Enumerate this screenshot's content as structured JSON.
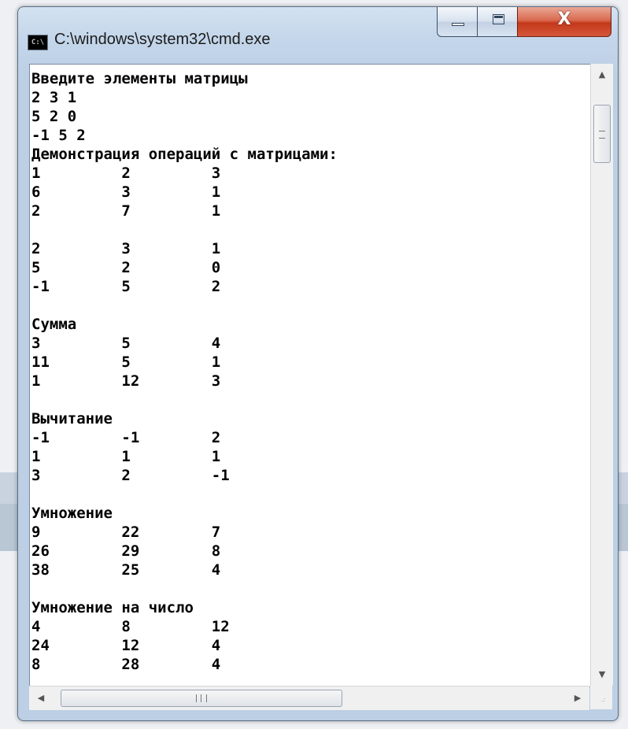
{
  "window": {
    "title": "C:\\windows\\system32\\cmd.exe",
    "icon_label": "C:\\",
    "icon_name": "console-app-icon",
    "buttons": {
      "minimize_icon": "minimize-icon",
      "maximize_icon": "maximize-icon",
      "close_icon": "close-icon",
      "close_glyph": "X"
    }
  },
  "console": {
    "lines": [
      "Введите элементы матрицы",
      "2 3 1",
      "5 2 0",
      "-1 5 2",
      "Демонстрация операций с матрицами:",
      "1         2         3",
      "6         3         1",
      "2         7         1",
      "",
      "2         3         1",
      "5         2         0",
      "-1        5         2",
      "",
      "Сумма",
      "3         5         4",
      "11        5         1",
      "1         12        3",
      "",
      "Вычитание",
      "-1        -1        2",
      "1         1         1",
      "3         2         -1",
      "",
      "Умножение",
      "9         22        7",
      "26        29        8",
      "38        25        4",
      "",
      "Умножение на число",
      "4         8         12",
      "24        12        4",
      "8         28        4"
    ]
  },
  "scrollbars": {
    "vertical": {
      "up_glyph": "▲",
      "down_glyph": "▼"
    },
    "horizontal": {
      "left_glyph": "◀",
      "right_glyph": "▶",
      "grip_label": "III"
    }
  },
  "colors": {
    "console_background": "#ffffff",
    "console_text": "#000000",
    "close_button": "#c4381a"
  }
}
